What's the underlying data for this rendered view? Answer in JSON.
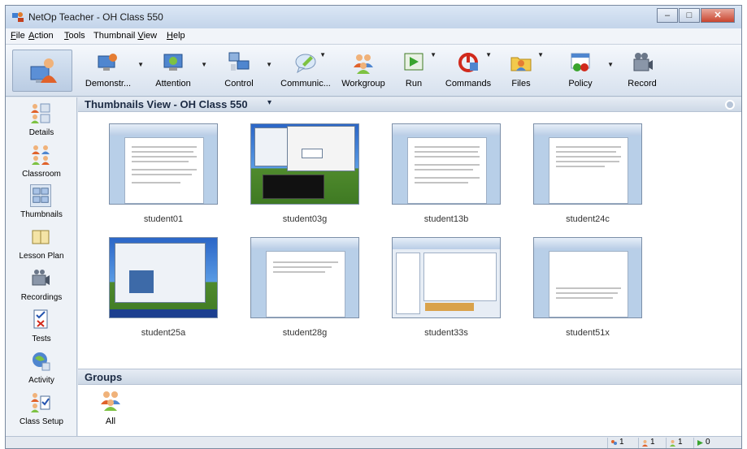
{
  "window": {
    "title": "NetOp Teacher - OH Class 550"
  },
  "menu": [
    {
      "label": "File",
      "ul": "F"
    },
    {
      "label": "Action",
      "ul": "A"
    },
    {
      "label": "Tools",
      "ul": "T"
    },
    {
      "label": "Thumbnail View",
      "ul": "V"
    },
    {
      "label": "Help",
      "ul": "H"
    }
  ],
  "toolbar": {
    "items": [
      {
        "label": "Demonstr...",
        "icon": "demonstrate-icon"
      },
      {
        "label": "Attention",
        "icon": "attention-icon"
      },
      {
        "label": "Control",
        "icon": "control-icon"
      },
      {
        "label": "Communic...",
        "icon": "communicate-icon"
      },
      {
        "label": "Workgroup",
        "icon": "workgroup-icon"
      },
      {
        "label": "Run",
        "icon": "run-icon"
      },
      {
        "label": "Commands",
        "icon": "commands-icon"
      },
      {
        "label": "Files",
        "icon": "files-icon"
      },
      {
        "label": "Policy",
        "icon": "policy-icon"
      },
      {
        "label": "Record",
        "icon": "record-icon"
      }
    ]
  },
  "sidebar": {
    "items": [
      {
        "label": "Details"
      },
      {
        "label": "Classroom"
      },
      {
        "label": "Thumbnails"
      },
      {
        "label": "Lesson Plan"
      },
      {
        "label": "Recordings"
      },
      {
        "label": "Tests"
      },
      {
        "label": "Activity"
      },
      {
        "label": "Class Setup"
      }
    ]
  },
  "view": {
    "title": "Thumbnails View - OH Class 550",
    "caret": "▾"
  },
  "thumbnails": [
    {
      "label": "student01"
    },
    {
      "label": "student03g"
    },
    {
      "label": "student13b"
    },
    {
      "label": "student24c"
    },
    {
      "label": "student25a"
    },
    {
      "label": "student28g"
    },
    {
      "label": "student33s"
    },
    {
      "label": "student51x"
    }
  ],
  "groups": {
    "title": "Groups",
    "items": [
      {
        "label": "All"
      }
    ]
  },
  "status": [
    "1",
    "1",
    "1",
    "0"
  ],
  "colors": {
    "accent": "#1c2b44",
    "header": "#cdd8e6"
  }
}
